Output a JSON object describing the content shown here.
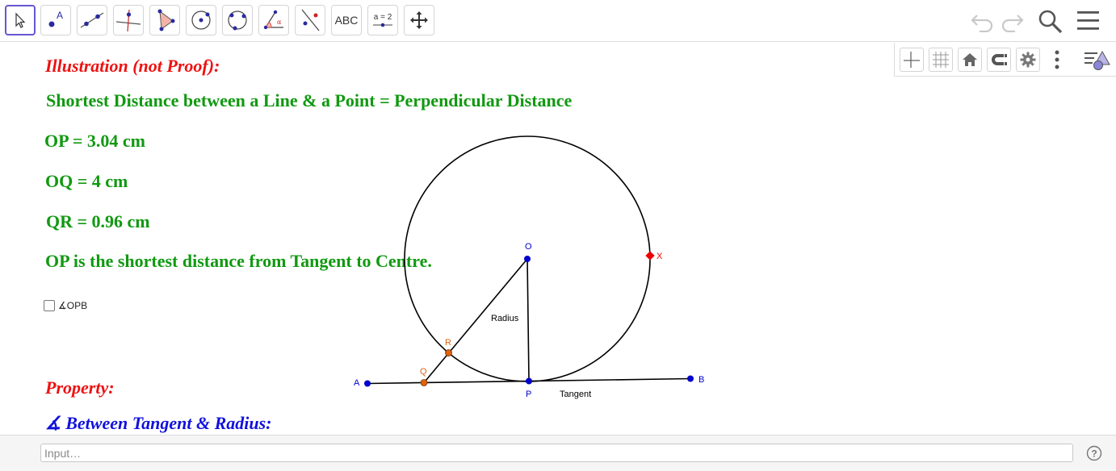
{
  "toolbar": {
    "tools": [
      {
        "name": "move-tool",
        "label": ""
      },
      {
        "name": "point-tool",
        "label": ""
      },
      {
        "name": "line-tool",
        "label": ""
      },
      {
        "name": "perpendicular-line-tool",
        "label": ""
      },
      {
        "name": "polygon-tool",
        "label": ""
      },
      {
        "name": "circle-center-point-tool",
        "label": ""
      },
      {
        "name": "circle-through-three-points-tool",
        "label": ""
      },
      {
        "name": "angle-tool",
        "label": ""
      },
      {
        "name": "reflect-tool",
        "label": ""
      },
      {
        "name": "text-tool",
        "label": "ABC"
      },
      {
        "name": "slider-tool",
        "label": "a = 2"
      },
      {
        "name": "move-graphics-view-tool",
        "label": ""
      }
    ],
    "selected_tool": "move-tool"
  },
  "graphics": {
    "heading_illustration": "Illustration (not Proof):",
    "subtitle": "Shortest Distance between a Line & a Point = Perpendicular Distance",
    "op_text": "OP = 3.04 cm",
    "oq_text": "OQ = 4 cm",
    "qr_text": "QR = 0.96 cm",
    "conclusion": "OP is the shortest distance from Tangent to Centre.",
    "checkbox_label": "∡OPB",
    "checkbox_checked": false,
    "heading_property": "Property:",
    "property_text": "∡ Between Tangent & Radius:"
  },
  "points": {
    "O": "O",
    "X": "X",
    "R": "R",
    "Q": "Q",
    "A": "A",
    "P": "P",
    "B": "B"
  },
  "segment_labels": {
    "radius": "Radius",
    "tangent": "Tangent"
  },
  "input": {
    "placeholder": "Input…",
    "value": ""
  },
  "colors": {
    "accent": "#6557d2",
    "red_text": "#ee1111",
    "green_text": "#119911",
    "blue_text": "#1111dd",
    "point_blue": "#0000cc",
    "point_orange": "#e0620f",
    "point_red": "#ee0000"
  }
}
